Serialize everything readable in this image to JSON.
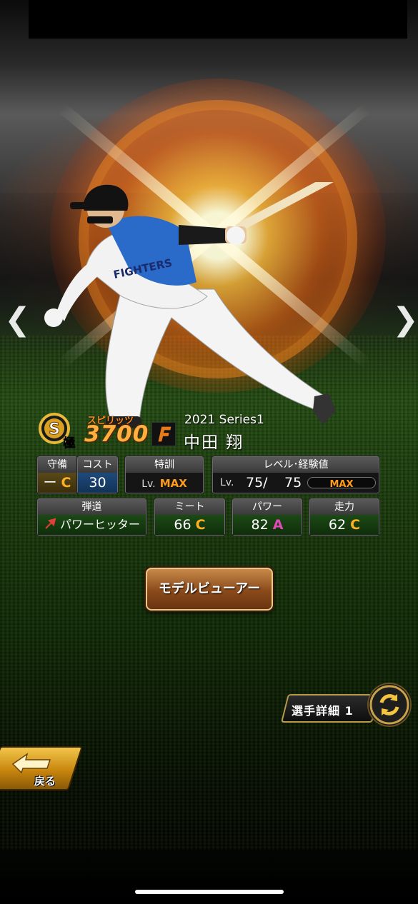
{
  "player": {
    "rank_badge": "極",
    "rank_letter": "S",
    "spirits_label": "スピリッツ",
    "spirits_value": "3700",
    "series": "2021 Series1",
    "name": "中田 翔"
  },
  "stats": {
    "defense": {
      "label": "守備",
      "value": "ー",
      "grade": "C"
    },
    "cost": {
      "label": "コスト",
      "value": "30"
    },
    "training": {
      "label": "特訓",
      "prefix": "Lv.",
      "value": "MAX"
    },
    "level": {
      "label": "レベル･経験値",
      "prefix": "Lv.",
      "current": "75",
      "sep": "/",
      "max": "75",
      "bar_label": "MAX"
    },
    "trajectory": {
      "label": "弾道",
      "value": "パワーヒッター",
      "arrow_color": "#e0403a"
    },
    "meet": {
      "label": "ミート",
      "value": "66",
      "grade": "C"
    },
    "power": {
      "label": "パワー",
      "value": "82",
      "grade": "A"
    },
    "speed": {
      "label": "走力",
      "value": "62",
      "grade": "C"
    }
  },
  "buttons": {
    "model_viewer": "モデルビューアー",
    "player_detail": "選手詳細 1",
    "back": "戻る"
  },
  "nav": {
    "prev": "❮",
    "next": "❯"
  },
  "colors": {
    "grade_C": "#ffb020",
    "grade_A": "#e04ab8",
    "max_accent": "#ff9a1a",
    "spirits_accent": "#ffb040"
  }
}
